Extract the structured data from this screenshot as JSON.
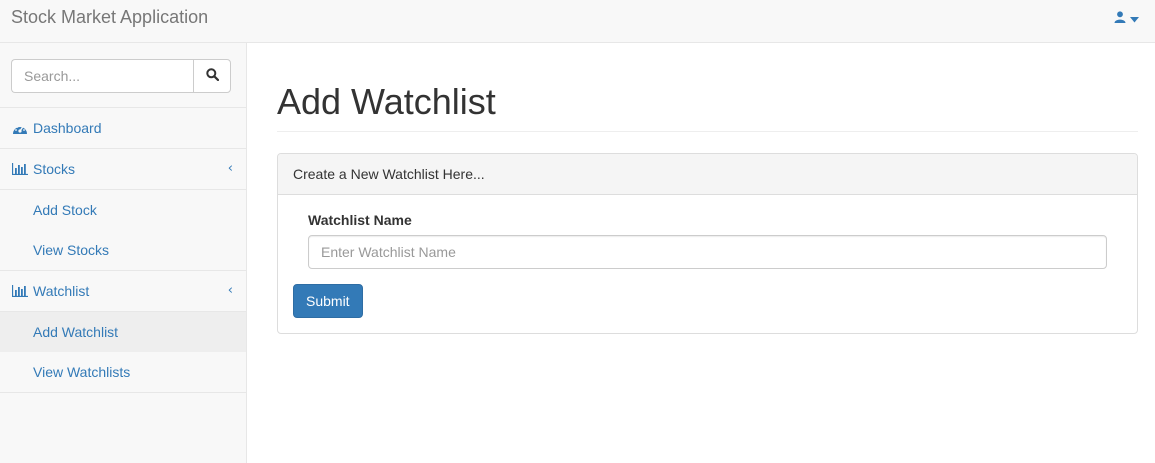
{
  "app": {
    "brand": "Stock Market Application"
  },
  "header": {
    "user_icon": "user-icon",
    "caret_icon": "caret-down-icon"
  },
  "sidebar": {
    "search": {
      "placeholder": "Search...",
      "icon": "search-icon"
    },
    "items": [
      {
        "label": "Dashboard",
        "icon": "dashboard-icon"
      },
      {
        "label": "Stocks",
        "icon": "bar-chart-icon",
        "chevron": "‹",
        "children": [
          {
            "label": "Add Stock"
          },
          {
            "label": "View Stocks"
          }
        ]
      },
      {
        "label": "Watchlist",
        "icon": "bar-chart-icon",
        "chevron": "‹",
        "children": [
          {
            "label": "Add Watchlist",
            "active": true
          },
          {
            "label": "View Watchlists"
          }
        ]
      }
    ]
  },
  "main": {
    "title": "Add Watchlist",
    "panel": {
      "heading": "Create a New Watchlist Here...",
      "field_label": "Watchlist Name",
      "field_placeholder": "Enter Watchlist Name",
      "field_value": "",
      "submit_label": "Submit"
    }
  },
  "colors": {
    "link": "#337ab7",
    "primary_button": "#337ab7",
    "sidebar_bg": "#f8f8f8",
    "active_item_bg": "#eeeeee"
  }
}
